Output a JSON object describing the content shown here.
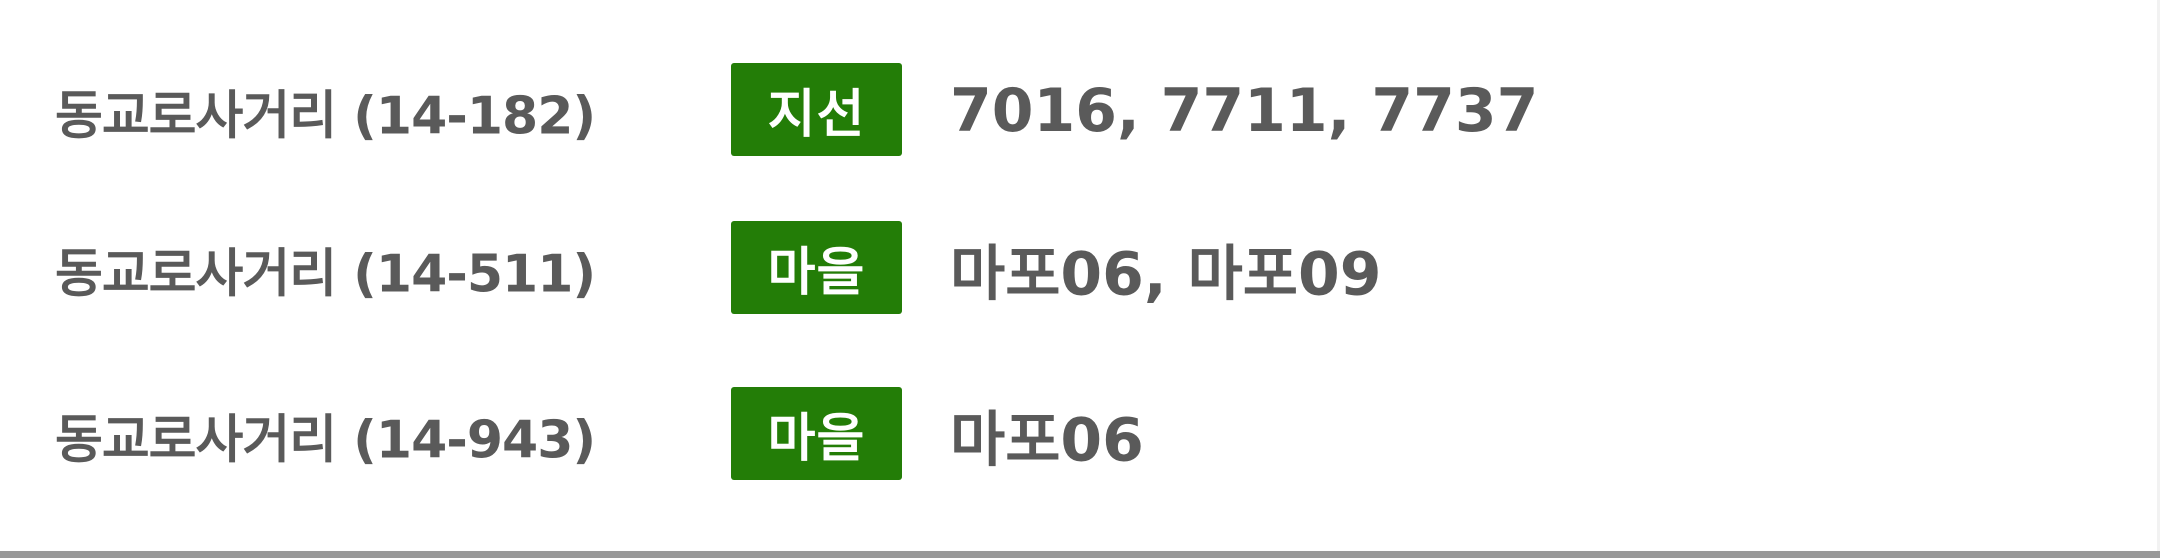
{
  "stops": [
    {
      "name": "동교로사거리 (14-182)",
      "badge": "지선",
      "routes": "7016, 7711, 7737"
    },
    {
      "name": "동교로사거리 (14-511)",
      "badge": "마을",
      "routes": "마포06, 마포09"
    },
    {
      "name": "동교로사거리 (14-943)",
      "badge": "마을",
      "routes": "마포06"
    }
  ],
  "colors": {
    "badge_background": "#237d07",
    "text": "#5a5a5a",
    "divider": "#999999"
  }
}
